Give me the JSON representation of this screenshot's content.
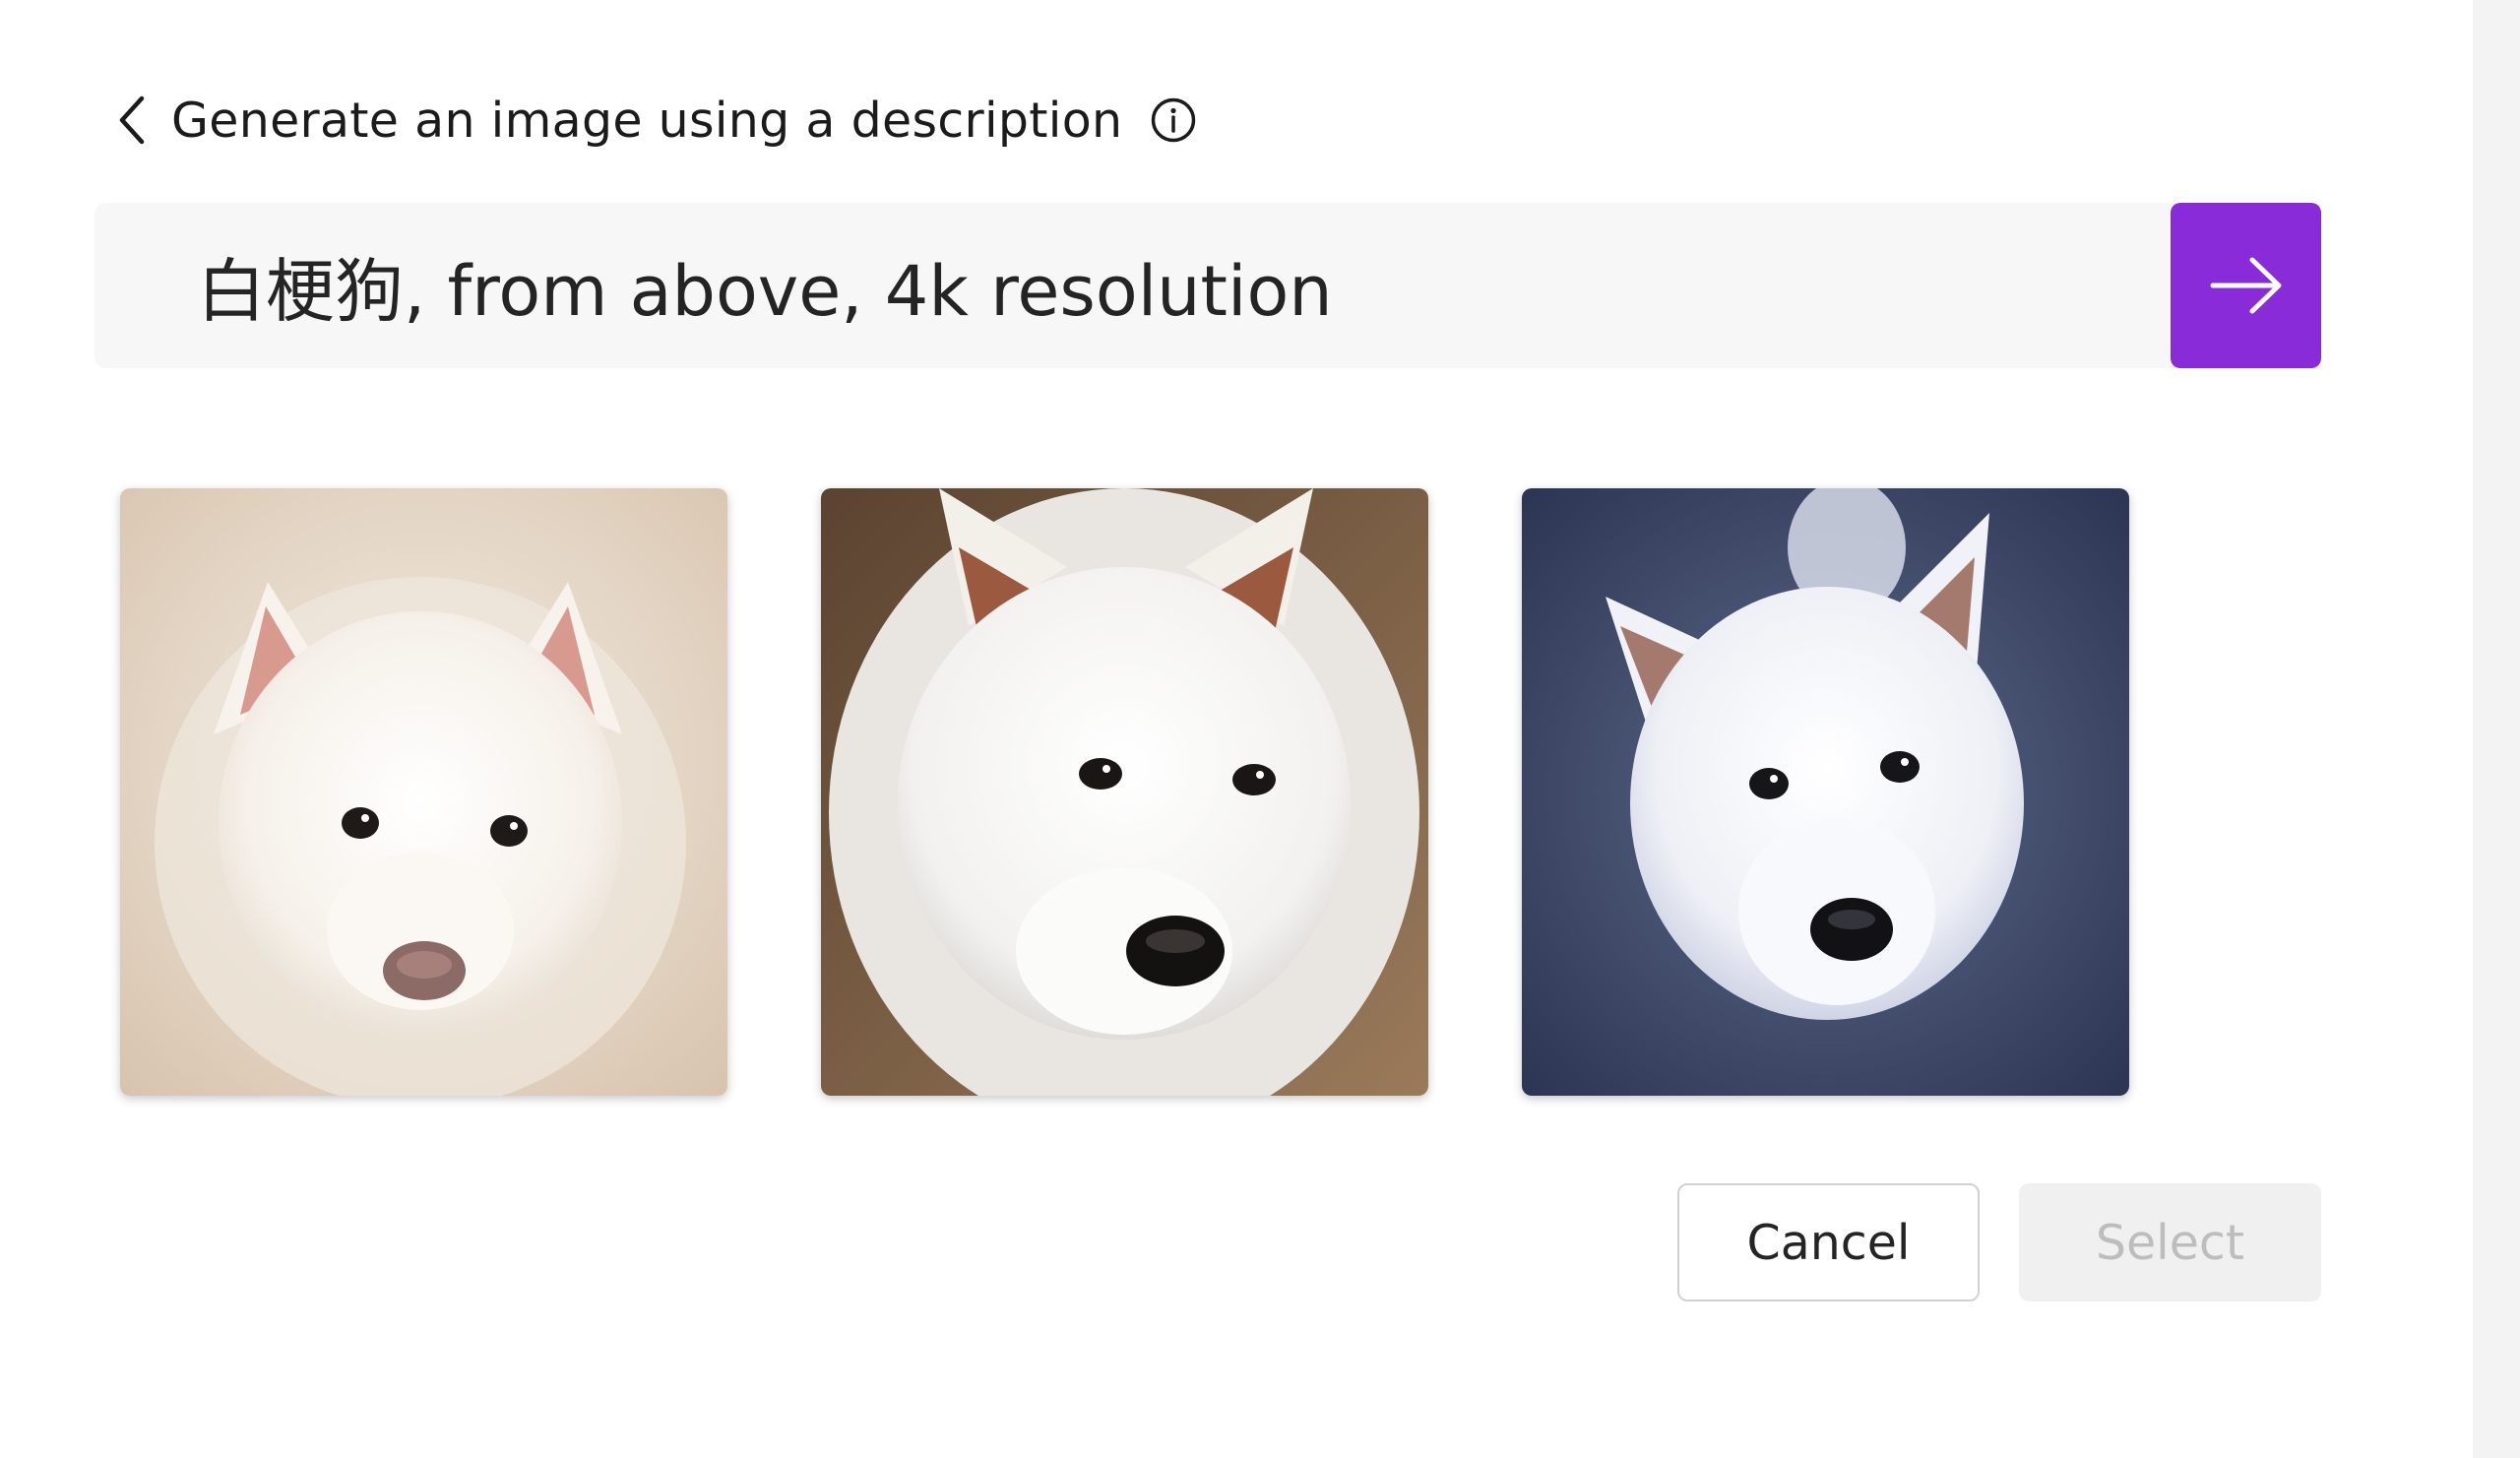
{
  "header": {
    "back_icon": "chevron-left-icon",
    "title": "Generate an image using a description",
    "info_icon": "info-icon"
  },
  "prompt": {
    "value": "白梗狗, from above, 4k resolution",
    "submit_icon": "arrow-right-icon"
  },
  "images": [
    {
      "subject": "white fluffy puppy from above",
      "background": "beige carpet"
    },
    {
      "subject": "white samoyed from above",
      "background": "brown floor"
    },
    {
      "subject": "white dog from above",
      "background": "dark blue ground"
    }
  ],
  "actions": {
    "cancel_label": "Cancel",
    "select_label": "Select",
    "select_enabled": false
  },
  "colors": {
    "accent": "#8a2bd9",
    "prompt_bg": "#f7f7f7"
  }
}
